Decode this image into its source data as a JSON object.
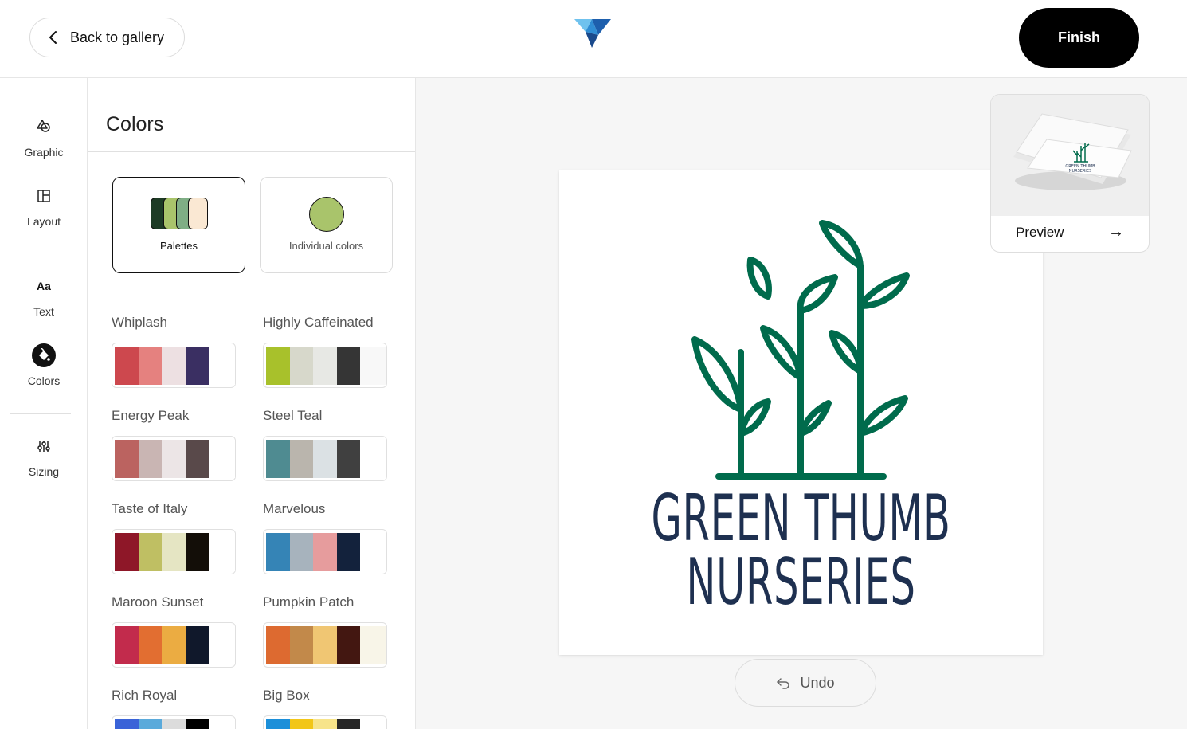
{
  "header": {
    "back_label": "Back to gallery",
    "finish_label": "Finish"
  },
  "rail": {
    "items": [
      {
        "label": "Graphic",
        "icon": "shapes-icon"
      },
      {
        "label": "Layout",
        "icon": "layout-icon"
      },
      {
        "label": "Text",
        "icon": "Aa"
      },
      {
        "label": "Colors",
        "icon": "paint-bucket-icon"
      },
      {
        "label": "Sizing",
        "icon": "sliders-icon"
      }
    ],
    "text_icon": "Aa"
  },
  "panel": {
    "title": "Colors",
    "modes": [
      {
        "label": "Palettes",
        "active": true
      },
      {
        "label": "Individual colors",
        "active": false
      }
    ],
    "palettes": [
      {
        "name": "Whiplash",
        "colors": [
          "#cd484e",
          "#e5817f",
          "#ede0e2",
          "#3a2f62",
          "#ffffff"
        ]
      },
      {
        "name": "Highly Caffeinated",
        "colors": [
          "#a8c12b",
          "#d7d8cb",
          "#e7e8e4",
          "#353535",
          "#f8f8f8"
        ]
      },
      {
        "name": "Energy Peak",
        "colors": [
          "#bb6360",
          "#c9b5b3",
          "#ece5e6",
          "#59494a",
          "#ffffff"
        ]
      },
      {
        "name": "Steel Teal",
        "colors": [
          "#4f8b91",
          "#bab5ad",
          "#dbe1e4",
          "#404040",
          "#ffffff"
        ]
      },
      {
        "name": "Taste of Italy",
        "colors": [
          "#8e1728",
          "#bfbf63",
          "#e5e5c3",
          "#130e08",
          "#ffffff"
        ]
      },
      {
        "name": "Marvelous",
        "colors": [
          "#3584b6",
          "#a7b3bd",
          "#e69c9d",
          "#13223c",
          "#ffffff"
        ]
      },
      {
        "name": "Maroon Sunset",
        "colors": [
          "#c22b4c",
          "#e26e31",
          "#ebac42",
          "#10182b",
          "#ffffff"
        ]
      },
      {
        "name": "Pumpkin Patch",
        "colors": [
          "#dd6a30",
          "#c2894a",
          "#f0c673",
          "#431711",
          "#f8f5e8"
        ]
      },
      {
        "name": "Rich Royal",
        "colors": [
          "#3a63d8",
          "#5aaadb",
          "#dcdcdc",
          "#000000",
          "#ffffff"
        ]
      },
      {
        "name": "Big Box",
        "colors": [
          "#1c8fd9",
          "#f2c618",
          "#f7e48a",
          "#262626",
          "#ffffff"
        ]
      }
    ]
  },
  "design": {
    "line1": "GREEN THUMB",
    "line2": "NURSERIES",
    "plant_color": "#006b4c",
    "text_color": "#1e3050"
  },
  "preview": {
    "label": "Preview",
    "arrow": "→"
  },
  "undo": {
    "label": "Undo"
  }
}
